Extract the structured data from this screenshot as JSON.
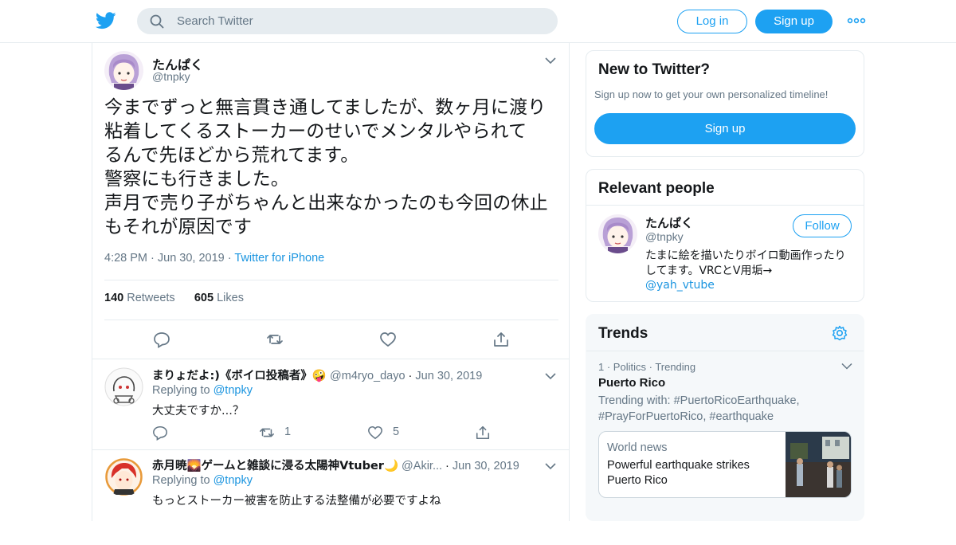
{
  "header": {
    "search_placeholder": "Search Twitter",
    "login_label": "Log in",
    "signup_label": "Sign up",
    "brand_color": "#1da1f2"
  },
  "tweet": {
    "author_name": "たんぱく",
    "author_handle": "@tnpky",
    "text": "今までずっと無言貫き通してましたが、数ヶ月に渡り\n粘着してくるストーカーのせいでメンタルやられて\nるんで先ほどから荒れてます。\n警察にも行きました。\n声月で売り子がちゃんと出来なかったのも今回の休止\nもそれが原因です",
    "time": "4:28 PM",
    "date": "Jun 30, 2019",
    "source": "Twitter for iPhone",
    "retweets_count": "140",
    "retweets_label": "Retweets",
    "likes_count": "605",
    "likes_label": "Likes"
  },
  "replies": [
    {
      "name": "まりょだよ:)《ボイロ投稿者》🤪",
      "handle": "@m4ryo_dayo",
      "date": "Jun 30, 2019",
      "replying_label": "Replying to",
      "replying_to": "@tnpky",
      "text": "大丈夫ですか...？",
      "reply_count": "",
      "retweet_count": "1",
      "like_count": "5"
    },
    {
      "name": "赤月暁🌄ゲームと雑談に浸る太陽神Vtuber🌙",
      "handle": "@Akir...",
      "date": "Jun 30, 2019",
      "replying_label": "Replying to",
      "replying_to": "@tnpky",
      "text": "もっとストーカー被害を防止する法整備が必要ですよね"
    }
  ],
  "sidebar": {
    "new_title": "New to Twitter?",
    "new_subtitle": "Sign up now to get your own personalized timeline!",
    "new_signup": "Sign up",
    "relevant_title": "Relevant people",
    "relevant_name": "たんぱく",
    "relevant_handle": "@tnpky",
    "follow_label": "Follow",
    "relevant_bio": "たまに絵を描いたりボイロ動画作ったりしてます。VRCとV用垢→",
    "relevant_bio_link": "@yah_vtube",
    "trends_title": "Trends",
    "trend_rank": "1",
    "trend_category": "Politics",
    "trend_status": "Trending",
    "trend_name": "Puerto Rico",
    "trend_with_label": "Trending with:",
    "trend_tag1": "#PuertoRicoEarthquake",
    "trend_tag2": "#PrayForPuertoRico",
    "trend_tag3": "#earthquake",
    "news_category": "World news",
    "news_headline": "Powerful earthquake strikes Puerto Rico"
  }
}
